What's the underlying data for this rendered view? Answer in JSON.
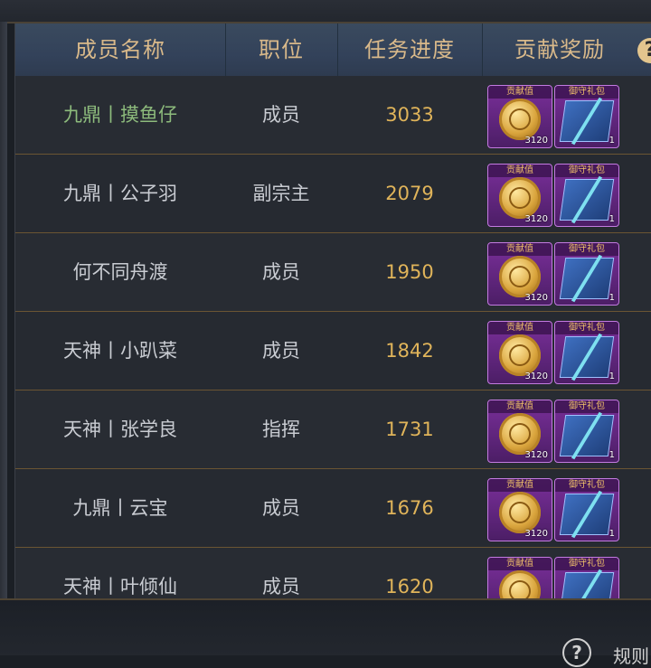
{
  "table": {
    "headers": {
      "name": "成员名称",
      "position": "职位",
      "progress": "任务进度",
      "reward": "贡献奖励"
    },
    "rows": [
      {
        "name": "九鼎丨摸鱼仔",
        "position": "成员",
        "progress": "3033",
        "name_color": "#8dbb7c"
      },
      {
        "name": "九鼎丨公子羽",
        "position": "副宗主",
        "progress": "2079"
      },
      {
        "name": "何不同舟渡",
        "position": "成员",
        "progress": "1950"
      },
      {
        "name": "天神丨小趴菜",
        "position": "成员",
        "progress": "1842"
      },
      {
        "name": "天神丨张学良",
        "position": "指挥",
        "progress": "1731"
      },
      {
        "name": "九鼎丨云宝",
        "position": "成员",
        "progress": "1676"
      },
      {
        "name": "天神丨叶倾仙",
        "position": "成员",
        "progress": "1620"
      }
    ],
    "reward_items": {
      "contribution": {
        "label": "贡献值",
        "qty": "3120",
        "icon": "gold-coin-icon"
      },
      "gift": {
        "label": "御守礼包",
        "qty": "1",
        "icon": "gift-scroll-icon"
      }
    }
  },
  "header_help": "?",
  "bottom": {
    "help": "?",
    "label": "规则"
  },
  "colors": {
    "header_text": "#d9b98a",
    "progress_text": "#e0b45a",
    "highlight_name": "#8dbb7c",
    "reward_frame": "#c37be0"
  }
}
